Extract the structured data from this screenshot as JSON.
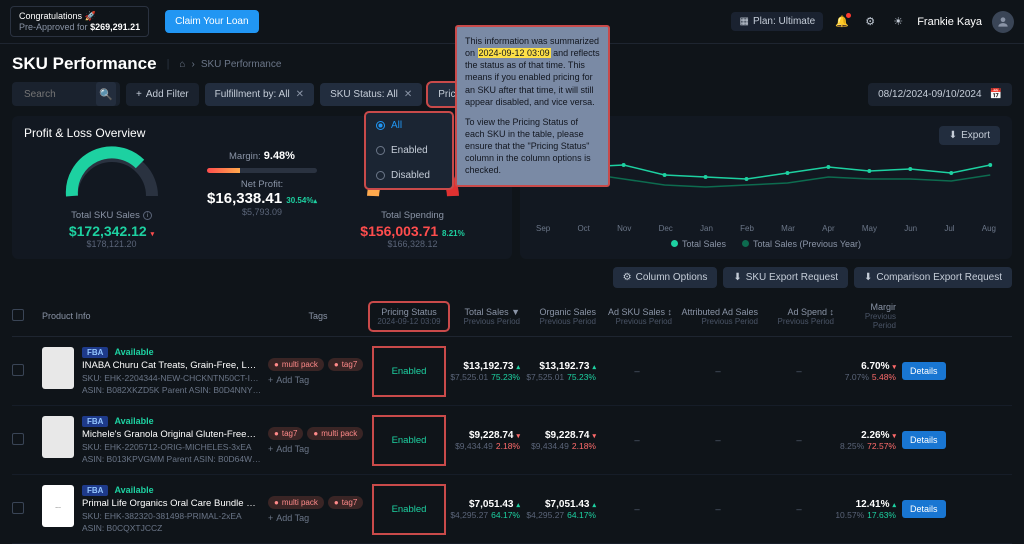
{
  "topbar": {
    "congrats": "Congratulations 🚀",
    "preapproved_label": "Pre-Approved for",
    "preapproved_amount": "$269,291.21",
    "claim": "Claim Your Loan",
    "plan_label": "Plan: Ultimate",
    "user_name": "Frankie Kaya"
  },
  "header": {
    "title": "SKU Performance",
    "breadcrumb": "SKU Performance"
  },
  "filters": {
    "search_placeholder": "Search",
    "add_filter": "Add Filter",
    "fulfillment": "Fulfillment by: All",
    "sku_status": "SKU Status: All",
    "pricing_status": "Pricing Status: All",
    "date_range": "08/12/2024-09/10/2024"
  },
  "dropdown": {
    "all": "All",
    "enabled": "Enabled",
    "disabled": "Disabled"
  },
  "tooltip": {
    "prefix": "This information was summarized on ",
    "timestamp": "2024-09-12 03:09",
    "mid": " and reflects the status as of that time. This means if you enabled pricing for an SKU after that time, it will still appear disabled, and vice versa.",
    "para2": "To view the Pricing Status of each SKU in the table, please ensure that the \"Pricing Status\" column in the column options is checked."
  },
  "pl": {
    "title": "Profit & Loss Overview",
    "export": "Export",
    "total_sku_sales_label": "Total SKU Sales",
    "total_sku_sales": "$172,342.12",
    "total_sku_sales_prev": "$178,121.20",
    "margin_label": "Margin:",
    "margin": "9.48%",
    "net_profit_label": "Net Profit:",
    "net_profit": "$16,338.41",
    "net_profit_delta": "30.54%",
    "net_profit_prev": "$5,793.09",
    "total_spending_label": "Total Spending",
    "total_spending": "$156,003.71",
    "total_spending_delta": "8.21%",
    "total_spending_prev": "$166,328.12"
  },
  "chart_data": {
    "type": "line",
    "x": [
      "Sep",
      "Oct",
      "Nov",
      "Dec",
      "Jan",
      "Feb",
      "Mar",
      "Apr",
      "May",
      "Jun",
      "Jul",
      "Aug"
    ],
    "series": [
      {
        "name": "Total Sales",
        "values": [
          480,
          460,
          470,
          420,
          410,
          400,
          430,
          460,
          440,
          450,
          430,
          470
        ]
      },
      {
        "name": "Total Sales (Previous Year)",
        "values": [
          420,
          430,
          400,
          370,
          360,
          370,
          380,
          410,
          400,
          400,
          390,
          420
        ]
      }
    ],
    "ylabel": "",
    "ylim": [
      0,
      500
    ],
    "ytick": "$500K",
    "legend_position": "bottom"
  },
  "table_actions": {
    "column_options": "Column Options",
    "sku_export": "SKU Export Request",
    "comparison_export": "Comparison Export Request"
  },
  "columns": {
    "product": "Product Info",
    "tags": "Tags",
    "pricing_status": "Pricing Status",
    "pricing_status_ts": "2024-09-12 03:09",
    "total_sales": "Total Sales",
    "organic_sales": "Organic Sales",
    "ad_sku_sales": "Ad SKU Sales",
    "attributed_ad_sales": "Attributed Ad Sales",
    "ad_spend": "Ad Spend",
    "margin": "Margir",
    "prev_period": "Previous Period",
    "details": "Details"
  },
  "common": {
    "fba": "FBA",
    "available": "Available",
    "enabled": "Enabled",
    "multi_pack": "multi pack",
    "tag7": "tag7",
    "add_tag": "Add Tag",
    "dash": "–"
  },
  "rows": [
    {
      "title": "INABA Churu Cat Treats, Grain-Free, Lickable, Sq...",
      "sku": "SKU: EHK-2204344-NEW-CHCKNTN50CT-INABA-EA",
      "asin": "ASIN: B082XKZD5K   Parent ASIN: B0D4NNYWQZ",
      "chip1": "multi pack",
      "chip2": "tag7",
      "total_sales": "$13,192.73",
      "total_sales_prev": "$7,525.01",
      "total_sales_delta": "75.23%",
      "organic": "$13,192.73",
      "organic_prev": "$7,525.01",
      "organic_delta": "75.23%",
      "margin": "6.70%",
      "margin_prev": "7.07%",
      "margin_delta": "5.48%"
    },
    {
      "title": "Michele's Granola Original Gluten-Free & Non-GMO...",
      "sku": "SKU: EHK-2205712-ORIG-MICHELES-3xEA",
      "asin": "ASIN: B013KPVGMM   Parent ASIN: B0D64W5X41",
      "chip1": "tag7",
      "chip2": "multi pack",
      "total_sales": "$9,228.74",
      "total_sales_prev": "$9,434.49",
      "total_sales_delta": "2.18%",
      "organic": "$9,228.74",
      "organic_prev": "$9,434.49",
      "organic_delta": "2.18%",
      "margin": "2.26%",
      "margin_prev": "8.25%",
      "margin_delta": "72.57%"
    },
    {
      "title": "Primal Life Organics Oral Care Bundle - Serum Bo...",
      "sku": "SKU: EHK-382320-381498-PRIMAL-2xEA",
      "asin": "ASIN: B0CQXTJCCZ",
      "chip1": "multi pack",
      "chip2": "tag7",
      "total_sales": "$7,051.43",
      "total_sales_prev": "$4,295.27",
      "total_sales_delta": "64.17%",
      "organic": "$7,051.43",
      "organic_prev": "$4,295.27",
      "organic_delta": "64.17%",
      "margin": "12.41%",
      "margin_prev": "10.57%",
      "margin_delta": "17.63%"
    }
  ]
}
